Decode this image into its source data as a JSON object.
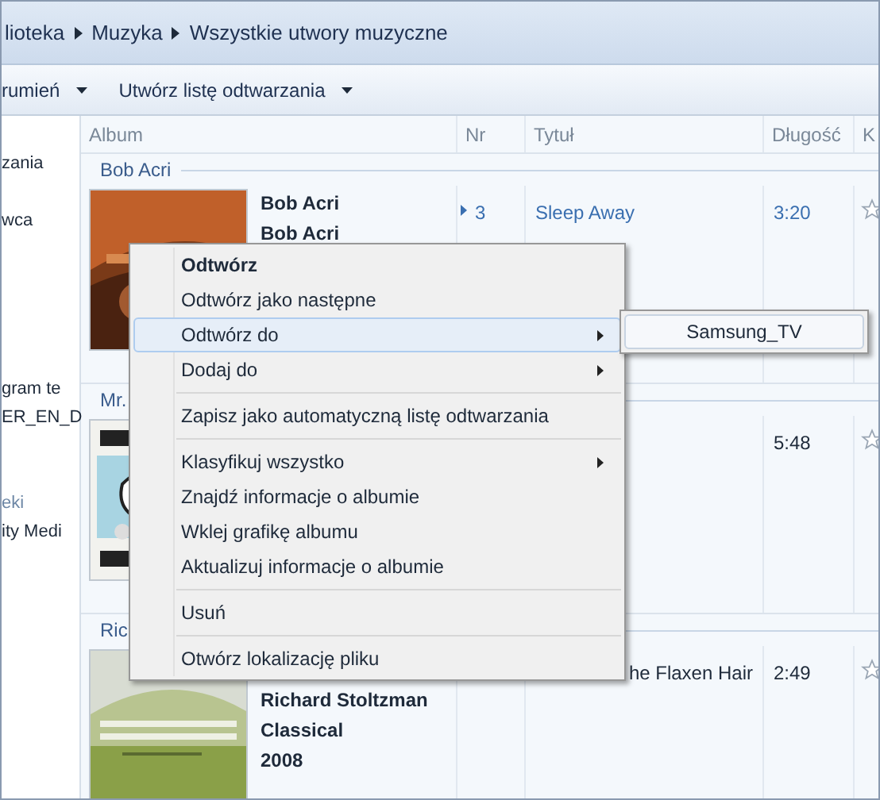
{
  "breadcrumb": [
    "lioteka",
    "Muzyka",
    "Wszystkie utwory muzyczne"
  ],
  "toolbar": [
    {
      "label": "rumień"
    },
    {
      "label": "Utwórz listę odtwarzania"
    }
  ],
  "nav": {
    "items": [
      {
        "label": "zania",
        "muted": false
      },
      {
        "label": "wca",
        "muted": false
      },
      {
        "label": "gram te",
        "muted": false
      },
      {
        "label": "ER_EN_D",
        "muted": false
      },
      {
        "label": "eki",
        "muted": true
      },
      {
        "label": "ity Medi",
        "muted": false
      }
    ]
  },
  "columns": [
    "Album",
    "Nr",
    "Tytuł",
    "Długość",
    "K"
  ],
  "groups": [
    {
      "header": "Bob Acri",
      "details": [
        "Bob Acri",
        "Bob Acri"
      ],
      "tracks": [
        {
          "nr": "3",
          "title": "Sleep Away",
          "length": "3:20",
          "playing": true,
          "clipped": false
        }
      ]
    },
    {
      "header": "Mr.",
      "tracks": [
        {
          "length": "5:48",
          "playing": false
        }
      ]
    },
    {
      "header": "Ric",
      "details": [
        "Richard Stoltzman",
        "Classical",
        "2008"
      ],
      "tracks": [
        {
          "title": "he Flaxen Hair",
          "length": "2:49",
          "playing": false,
          "clipped": true
        }
      ]
    }
  ],
  "context_menu": {
    "items": [
      {
        "kind": "item",
        "label": "Odtwórz",
        "bold": true,
        "submenu": false,
        "selected": false
      },
      {
        "kind": "item",
        "label": "Odtwórz jako następne",
        "bold": false,
        "submenu": false,
        "selected": false
      },
      {
        "kind": "item",
        "label": "Odtwórz do",
        "bold": false,
        "submenu": true,
        "selected": true
      },
      {
        "kind": "item",
        "label": "Dodaj do",
        "bold": false,
        "submenu": true,
        "selected": false
      },
      {
        "kind": "separator"
      },
      {
        "kind": "item",
        "label": "Zapisz jako automatyczną listę odtwarzania",
        "bold": false,
        "submenu": false,
        "selected": false
      },
      {
        "kind": "separator"
      },
      {
        "kind": "item",
        "label": "Klasyfikuj wszystko",
        "bold": false,
        "submenu": true,
        "selected": false
      },
      {
        "kind": "item",
        "label": "Znajdź informacje o albumie",
        "bold": false,
        "submenu": false,
        "selected": false
      },
      {
        "kind": "item",
        "label": "Wklej grafikę albumu",
        "bold": false,
        "submenu": false,
        "selected": false
      },
      {
        "kind": "item",
        "label": "Aktualizuj informacje o albumie",
        "bold": false,
        "submenu": false,
        "selected": false
      },
      {
        "kind": "separator"
      },
      {
        "kind": "item",
        "label": "Usuń",
        "bold": false,
        "submenu": false,
        "selected": false
      },
      {
        "kind": "separator"
      },
      {
        "kind": "item",
        "label": "Otwórz lokalizację pliku",
        "bold": false,
        "submenu": false,
        "selected": false
      }
    ]
  },
  "submenu": {
    "items": [
      "Samsung_TV"
    ]
  }
}
